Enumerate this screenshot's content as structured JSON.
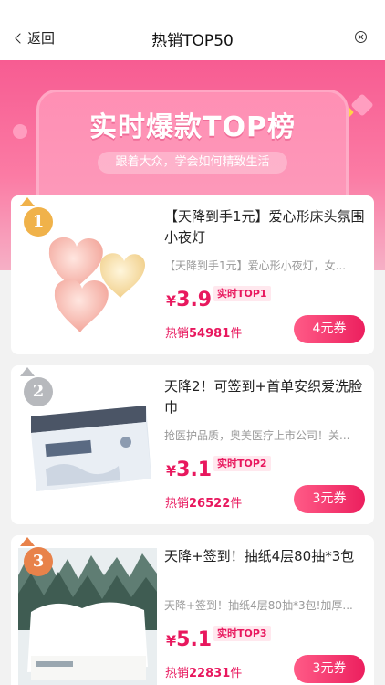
{
  "nav": {
    "back_label": "返回",
    "title": "热销TOP50"
  },
  "banner": {
    "headline": "实时爆款TOP榜",
    "subtitle": "跟着大众，学会如何精致生活"
  },
  "items": [
    {
      "medal": "1",
      "medal_color": "#f0b24a",
      "name": "【天降到手1元】爱心形床头氛围小夜灯",
      "desc": "【天降到手1元】爱心形小夜灯，女...",
      "currency": "¥",
      "price": "3.9",
      "rank": "实时TOP1",
      "sold_prefix": "热销",
      "sold_count": "54981",
      "sold_suffix": "件",
      "coupon": "4元券",
      "image": "heart-night-light-image"
    },
    {
      "medal": "2",
      "medal_color": "#b7b9bd",
      "name": "天降2！可签到+首单安织爱洗脸巾",
      "desc": "抢医护品质，奥美医疗上市公司！关...",
      "currency": "¥",
      "price": "3.1",
      "rank": "实时TOP2",
      "sold_prefix": "热销",
      "sold_count": "26522",
      "sold_suffix": "件",
      "coupon": "3元券",
      "image": "face-towel-pack-image"
    },
    {
      "medal": "3",
      "medal_color": "#e8824a",
      "name": "天降+签到！抽纸4层80抽*3包",
      "desc": "天降+签到！抽纸4层80抽*3包!加厚...",
      "currency": "¥",
      "price": "5.1",
      "rank": "实时TOP3",
      "sold_prefix": "热销",
      "sold_count": "22831",
      "sold_suffix": "件",
      "coupon": "3元券",
      "image": "tissue-pack-image"
    }
  ],
  "colors": {
    "accent": "#e8185e",
    "banner_top": "#f75c92"
  }
}
